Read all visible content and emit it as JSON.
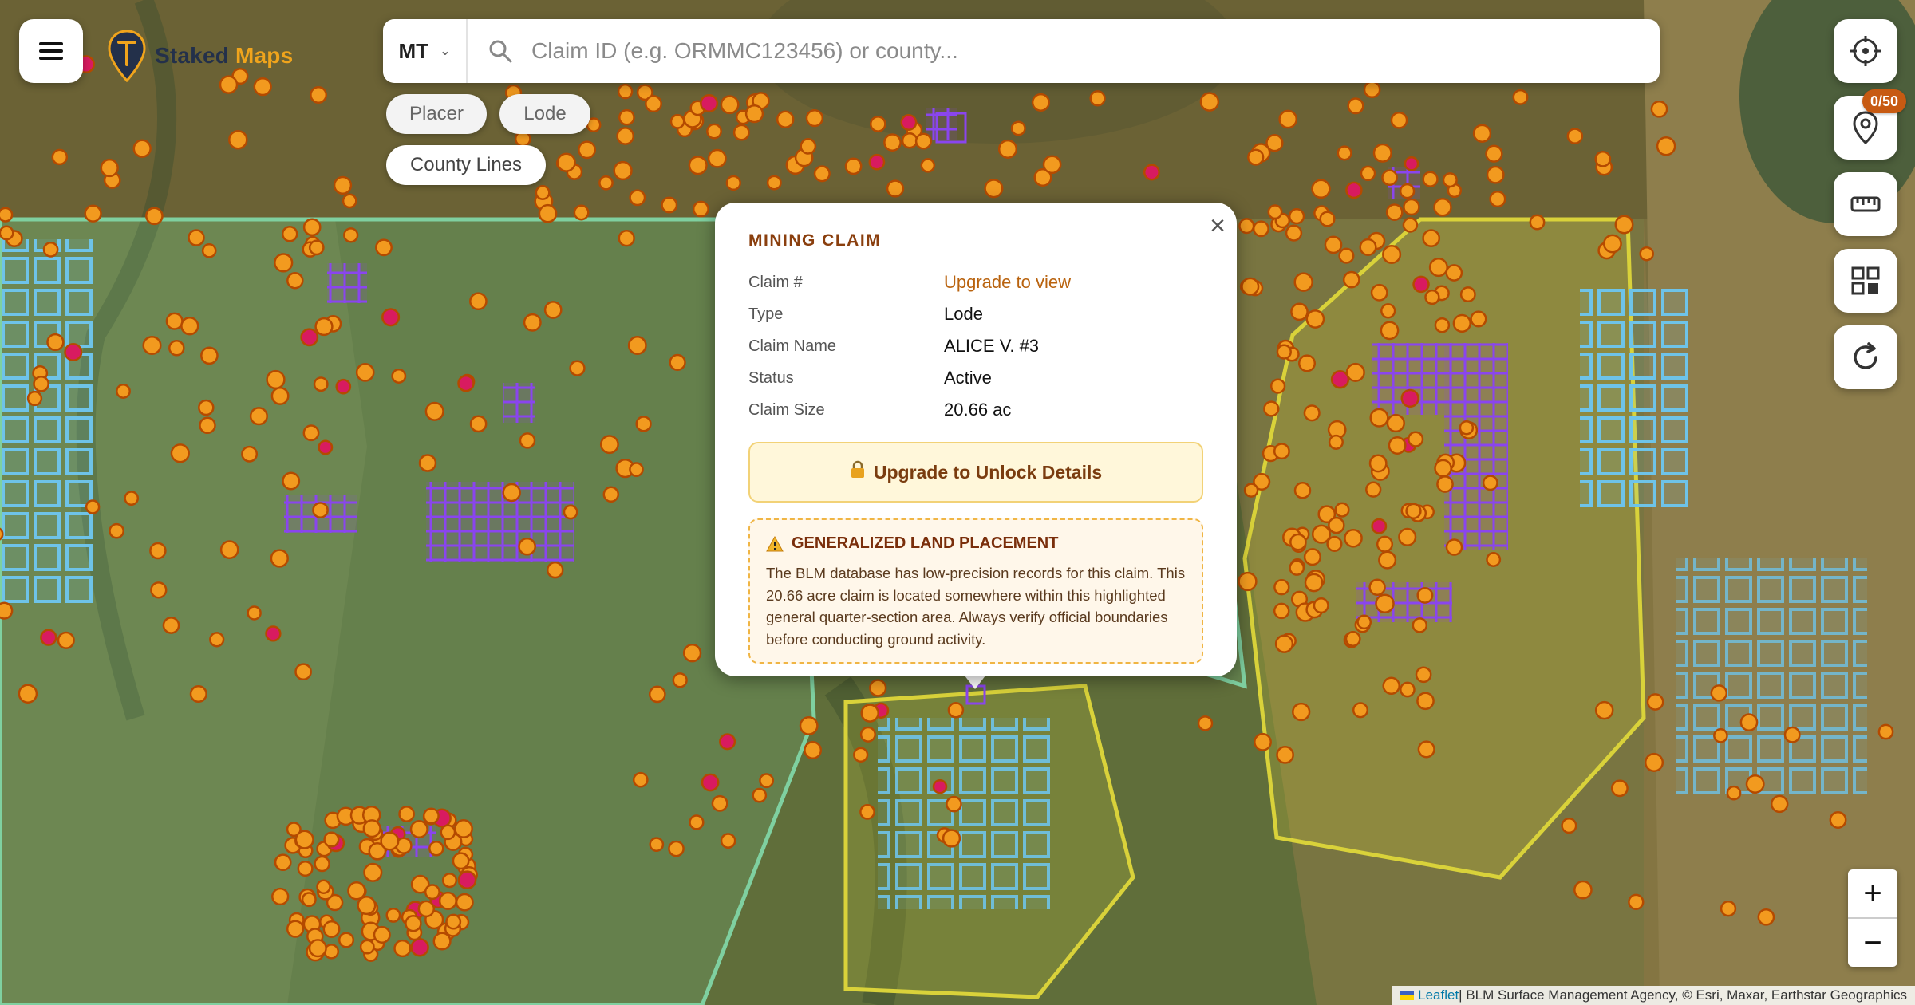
{
  "app": {
    "logo_part1": "Staked",
    "logo_part2": "Maps",
    "brand_color": "#f0a41c",
    "menu_icon": "hamburger-menu-icon"
  },
  "search": {
    "state_value": "MT",
    "placeholder": "Claim ID (e.g. ORMMC123456) or county...",
    "value": ""
  },
  "filters": {
    "placer_label": "Placer",
    "lode_label": "Lode",
    "county_lines_label": "County Lines"
  },
  "toolbar": {
    "locate_icon": "crosshair-icon",
    "saved_icon": "map-pin-icon",
    "saved_count": "0/50",
    "measure_icon": "ruler-icon",
    "layers_icon": "grid-layers-icon",
    "refresh_icon": "refresh-icon"
  },
  "zoom": {
    "in_label": "+",
    "out_label": "−"
  },
  "attribution": {
    "leaflet": "Leaflet",
    "rest": " | BLM Surface Management Agency, © Esri, Maxar, Earthstar Geographics"
  },
  "popup": {
    "title": "MINING CLAIM",
    "fields": [
      {
        "label": "Claim #",
        "value": "Upgrade to view"
      },
      {
        "label": "Type",
        "value": "Lode"
      },
      {
        "label": "Claim Name",
        "value": "ALICE V. #3"
      },
      {
        "label": "Status",
        "value": "Active"
      },
      {
        "label": "Claim Size",
        "value": "20.66 ac"
      }
    ],
    "unlock_label": "Upgrade to Unlock Details",
    "warning_title": "GENERALIZED LAND PLACEMENT",
    "warning_text": "The BLM database has low-precision records for this claim. This 20.66 acre claim is located somewhere within this highlighted general quarter-section area. Always verify official boundaries before conducting ground activity.",
    "close_label": "×"
  },
  "colors": {
    "claim_point": "#f29a1f",
    "claim_point_stroke": "#b44a00",
    "claim_point_alt": "#d81b60",
    "lode_grid": "#8a45ee",
    "blm_land": "#7fd0a0",
    "usfs_land": "#6ec3e8",
    "state_land": "#d9d23a"
  }
}
